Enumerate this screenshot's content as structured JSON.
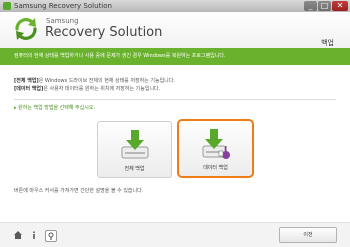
{
  "window": {
    "title": "Samsung Recovery Solution",
    "controls": [
      "_",
      "□",
      "✕"
    ]
  },
  "header": {
    "brand_small": "Samsung",
    "brand_big": "Recovery Solution",
    "page_title": "백업"
  },
  "banner": {
    "text": "컴퓨터의 현재 상태를 백업하거나 사용 중에 문제가 생긴 경우 Windows를 복원하는 프로그램입니다."
  },
  "info": {
    "line1_bold": "[전체 백업]",
    "line1_rest": "은 Windows 드라이브 전체의 현재 상태를 저장하는 기능입니다.",
    "line2_bold": "[데이터 백업]",
    "line2_rest": "은 사용자 데이터를 원하는 위치에 저장하는 기능입니다."
  },
  "instruction": "▸ 원하는 백업 방법을 선택해 주십시오.",
  "options": [
    {
      "label": "전체 백업",
      "icon": "full-backup-icon",
      "selected": false
    },
    {
      "label": "데이터 백업",
      "icon": "data-backup-icon",
      "selected": true
    }
  ],
  "hint": "버튼에 마우스 커서를 가져가면 간단한 설명을 볼 수 있습니다.",
  "footer": {
    "icons": [
      "home-icon",
      "info-icon",
      "tools-icon"
    ],
    "prev_label": "이전"
  },
  "colors": {
    "accent_green": "#6ab12e",
    "selection_orange": "#f07c16"
  }
}
